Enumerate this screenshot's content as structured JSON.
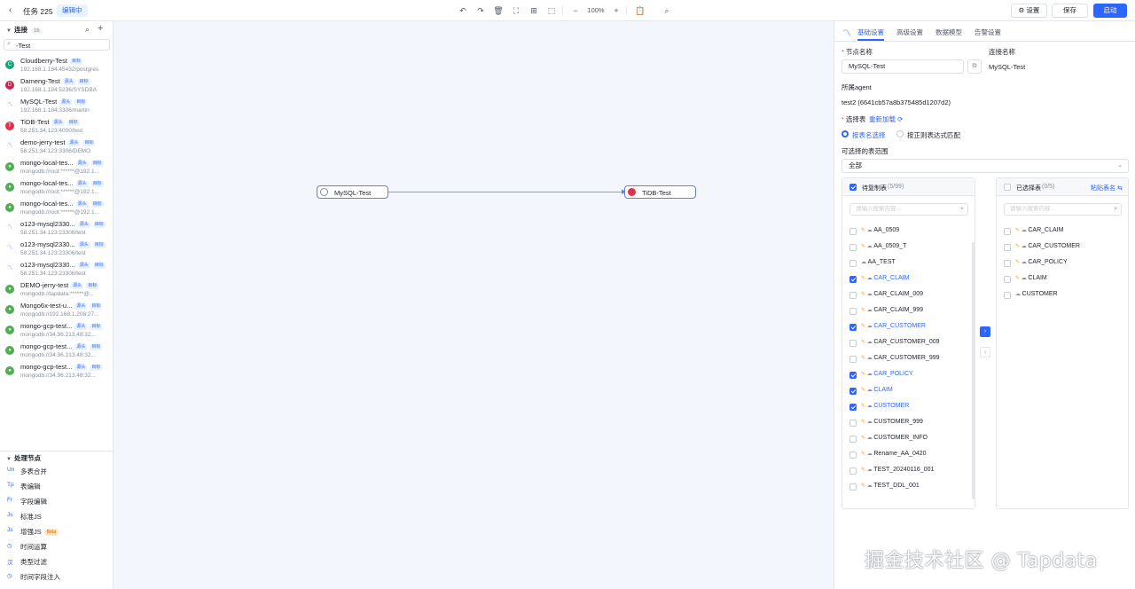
{
  "header": {
    "back_icon": "chevron-left",
    "task_title": "任务 225",
    "status": "编辑中",
    "zoom": "100%",
    "settings_label": "⚙ 设置",
    "save_label": "保存",
    "start_label": "启动"
  },
  "sidebar": {
    "connections_title": "连接",
    "connections_count": "16",
    "search_value": "-Test",
    "connections": [
      {
        "name": "Cloudberry-Test",
        "tags": [
          "目标"
        ],
        "addr": "192.168.1.184:45432/postgres",
        "icon": "cloudberry-icon",
        "color": "#1aa37a",
        "glyph": "C"
      },
      {
        "name": "Dameng-Test",
        "tags": [
          "源头",
          "目标"
        ],
        "addr": "192.168.1.184:5236/SYSDBA",
        "icon": "dameng-icon",
        "color": "#c7254e",
        "glyph": "D"
      },
      {
        "name": "MySQL-Test",
        "tags": [
          "源头",
          "目标"
        ],
        "addr": "192.168.1.184:3306/martin",
        "icon": "mysql-icon",
        "color": "#ffffff",
        "glyph": "〽"
      },
      {
        "name": "TiDB-Test",
        "tags": [
          "源头",
          "目标"
        ],
        "addr": "58.251.34.123:4000/test",
        "icon": "tidb-icon",
        "color": "#e1304a",
        "glyph": "T"
      },
      {
        "name": "demo-jerry-test",
        "tags": [
          "源头",
          "目标"
        ],
        "addr": "58.251.34.123:3306/DEMO",
        "icon": "mysql-icon",
        "color": "#ffffff",
        "glyph": "〽"
      },
      {
        "name": "mongo-local-tes...",
        "tags": [
          "源头",
          "目标"
        ],
        "addr": "mongodb://root:******@192.1...",
        "icon": "mongodb-icon",
        "color": "#4caf50",
        "glyph": "●"
      },
      {
        "name": "mongo-local-tes...",
        "tags": [
          "源头",
          "目标"
        ],
        "addr": "mongodb://root:******@192.1...",
        "icon": "mongodb-icon",
        "color": "#4caf50",
        "glyph": "●"
      },
      {
        "name": "mongo-local-tes...",
        "tags": [
          "源头",
          "目标"
        ],
        "addr": "mongodb://root:******@192.1...",
        "icon": "mongodb-icon",
        "color": "#4caf50",
        "glyph": "●"
      },
      {
        "name": "o123-mysql2330...",
        "tags": [
          "源头",
          "目标"
        ],
        "addr": "58.251.34.123:23306/test",
        "icon": "mysql-icon",
        "color": "#ffffff",
        "glyph": "〽"
      },
      {
        "name": "o123-mysql2330...",
        "tags": [
          "源头",
          "目标"
        ],
        "addr": "58.251.34.123:23306/test",
        "icon": "mysql-icon",
        "color": "#ffffff",
        "glyph": "〽"
      },
      {
        "name": "o123-mysql2330...",
        "tags": [
          "源头",
          "目标"
        ],
        "addr": "58.251.34.123:23306/test",
        "icon": "mysql-icon",
        "color": "#ffffff",
        "glyph": "〽"
      },
      {
        "name": "DEMO-jerry-test",
        "tags": [
          "源头",
          "目标"
        ],
        "addr": "mongodb://tapdata:******@...",
        "icon": "mongodb-icon",
        "color": "#4caf50",
        "glyph": "●"
      },
      {
        "name": "Mongo6x-test-u...",
        "tags": [
          "源头",
          "目标"
        ],
        "addr": "mongodb://192.168.1.208:27...",
        "icon": "mongodb-icon",
        "color": "#4caf50",
        "glyph": "●"
      },
      {
        "name": "mongo-gcp-test...",
        "tags": [
          "源头",
          "目标"
        ],
        "addr": "mongodb://34.96.213.48:32...",
        "icon": "mongodb-icon",
        "color": "#4caf50",
        "glyph": "●"
      },
      {
        "name": "mongo-gcp-test...",
        "tags": [
          "源头",
          "目标"
        ],
        "addr": "mongodb://34.96.213.48:32...",
        "icon": "mongodb-icon",
        "color": "#4caf50",
        "glyph": "●"
      },
      {
        "name": "mongo-gcp-test...",
        "tags": [
          "源头",
          "目标"
        ],
        "addr": "mongodb://34.96.213.48:32...",
        "icon": "mongodb-icon",
        "color": "#4caf50",
        "glyph": "●"
      }
    ],
    "process_title": "处理节点",
    "process_nodes": [
      {
        "abbr": "Un",
        "name": "多表合并",
        "beta": ""
      },
      {
        "abbr": "Tp",
        "name": "表编辑",
        "beta": ""
      },
      {
        "abbr": "Fr",
        "name": "字段编辑",
        "beta": ""
      },
      {
        "abbr": "Js",
        "name": "标准JS",
        "beta": ""
      },
      {
        "abbr": "Js",
        "name": "增强JS",
        "beta": "Beta"
      },
      {
        "abbr": "◷",
        "name": "时间运算",
        "beta": ""
      },
      {
        "abbr": "汉",
        "name": "类型过滤",
        "beta": ""
      },
      {
        "abbr": "◷",
        "name": "时间字段注入",
        "beta": ""
      }
    ]
  },
  "canvas": {
    "source_node": "MySQL-Test",
    "target_node": "TiDB-Test"
  },
  "panel": {
    "tabs": [
      "基础设置",
      "高级设置",
      "数据模型",
      "告警设置"
    ],
    "node_name_label": "节点名称",
    "node_name_value": "MySQL-Test",
    "conn_name_label": "连接名称",
    "conn_name_value": "MySQL-Test",
    "agent_label": "所属agent",
    "agent_value": "test2 (6641cb57a8b375485d1207d2)",
    "select_table_label": "选择表",
    "reload_label": "重新加载 ⟳",
    "mode_by_name": "按表名选择",
    "mode_by_regex": "按正则表达式匹配",
    "range_label": "可选择的表范围",
    "range_value": "全部",
    "left_box": {
      "title": "待复制表",
      "count": "(5/99)",
      "search_placeholder": "请输入搜索内容...",
      "rows": [
        {
          "name": "AA_0509",
          "checked": false,
          "key": true
        },
        {
          "name": "AA_0509_T",
          "checked": false,
          "key": true
        },
        {
          "name": "AA_TEST",
          "checked": false,
          "key": false
        },
        {
          "name": "CAR_CLAIM",
          "checked": true,
          "key": true
        },
        {
          "name": "CAR_CLAIM_009",
          "checked": false,
          "key": true
        },
        {
          "name": "CAR_CLAIM_999",
          "checked": false,
          "key": true
        },
        {
          "name": "CAR_CUSTOMER",
          "checked": true,
          "key": true
        },
        {
          "name": "CAR_CUSTOMER_009",
          "checked": false,
          "key": true
        },
        {
          "name": "CAR_CUSTOMER_999",
          "checked": false,
          "key": true
        },
        {
          "name": "CAR_POLICY",
          "checked": true,
          "key": true
        },
        {
          "name": "CLAIM",
          "checked": true,
          "key": true
        },
        {
          "name": "CUSTOMER",
          "checked": true,
          "key": true
        },
        {
          "name": "CUSTOMER_999",
          "checked": false,
          "key": true
        },
        {
          "name": "CUSTOMER_INFO",
          "checked": false,
          "key": true
        },
        {
          "name": "Rename_AA_0420",
          "checked": false,
          "key": true
        },
        {
          "name": "TEST_20240116_001",
          "checked": false,
          "key": true
        },
        {
          "name": "TEST_DDL_001",
          "checked": false,
          "key": true
        }
      ]
    },
    "right_box": {
      "title": "已选择表",
      "count": "(0/5)",
      "paste_label": "粘贴表名 ⇆",
      "search_placeholder": "请输入搜索内容...",
      "rows": [
        {
          "name": "CAR_CLAIM",
          "key": true
        },
        {
          "name": "CAR_CUSTOMER",
          "key": true
        },
        {
          "name": "CAR_POLICY",
          "key": true
        },
        {
          "name": "CLAIM",
          "key": true
        },
        {
          "name": "CUSTOMER",
          "key": false
        }
      ]
    }
  },
  "watermark": "掘金技术社区 @ Tapdata",
  "colors": {
    "accent": "#2c65ff",
    "canvas": "#f4f6fd",
    "border": "#e5e6eb"
  }
}
